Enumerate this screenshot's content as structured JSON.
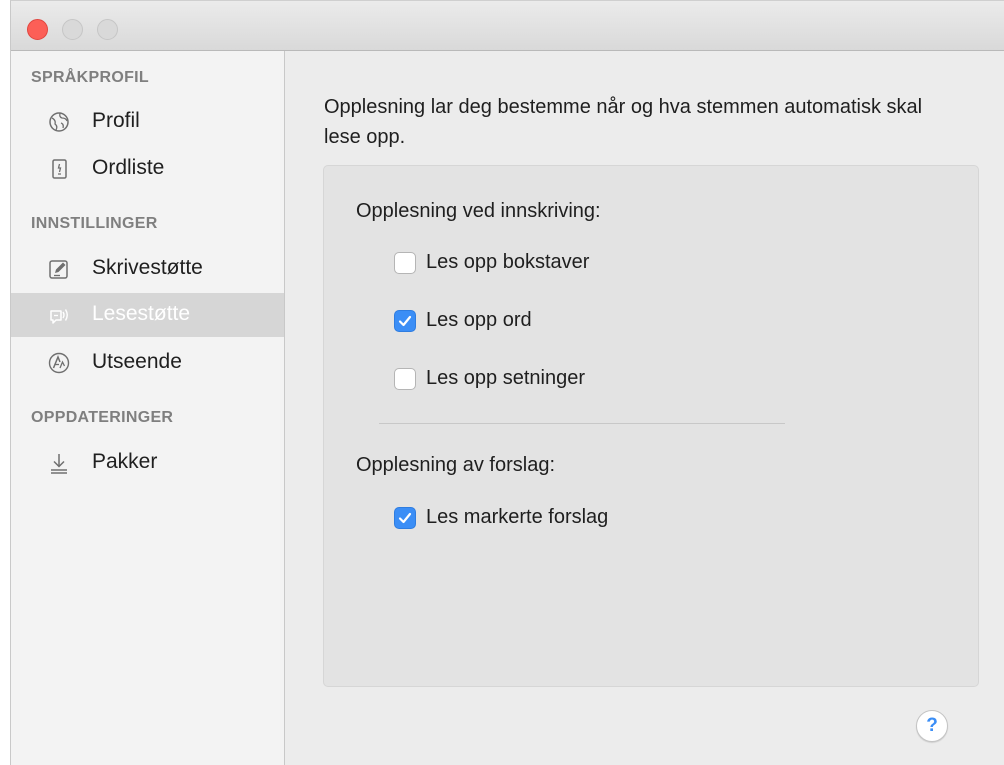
{
  "window": {
    "controls": [
      "close",
      "minimize",
      "zoom"
    ]
  },
  "sidebar": {
    "sections": [
      {
        "heading": "SPRÅKPROFIL",
        "items": [
          {
            "label": "Profil",
            "icon": "globe-icon",
            "selected": false
          },
          {
            "label": "Ordliste",
            "icon": "dictionary-icon",
            "selected": false
          }
        ]
      },
      {
        "heading": "INNSTILLINGER",
        "items": [
          {
            "label": "Skrivestøtte",
            "icon": "pen-icon",
            "selected": false
          },
          {
            "label": "Lesestøtte",
            "icon": "speech-icon",
            "selected": true
          },
          {
            "label": "Utseende",
            "icon": "appearance-icon",
            "selected": false
          }
        ]
      },
      {
        "heading": "OPPDATERINGER",
        "items": [
          {
            "label": "Pakker",
            "icon": "download-icon",
            "selected": false
          }
        ]
      }
    ]
  },
  "main": {
    "intro": "Opplesning lar deg bestemme når og hva stemmen automatisk skal lese opp.",
    "typing_group": {
      "heading": "Opplesning ved innskriving:",
      "options": [
        {
          "label": "Les opp bokstaver",
          "checked": false
        },
        {
          "label": "Les opp ord",
          "checked": true
        },
        {
          "label": "Les opp setninger",
          "checked": false
        }
      ]
    },
    "suggestion_group": {
      "heading": "Opplesning av forslag:",
      "options": [
        {
          "label": "Les markerte forslag",
          "checked": true
        }
      ]
    },
    "help_label": "?"
  },
  "colors": {
    "accent": "#3b8ef6",
    "close_button": "#fc5f57",
    "selected_row": "#d6d6d6"
  }
}
